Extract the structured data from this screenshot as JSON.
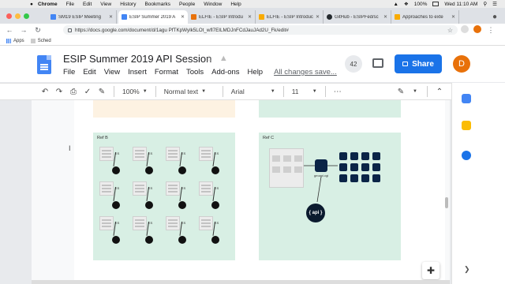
{
  "menubar": {
    "app": "Chrome",
    "items": [
      "File",
      "Edit",
      "View",
      "History",
      "Bookmarks",
      "People",
      "Window",
      "Help"
    ],
    "battery": "100%",
    "clock": "Wed 11:10 AM"
  },
  "tabs": [
    {
      "title": "SM19 ESIP Meeting",
      "color": "#4285f4"
    },
    {
      "title": "ESIP Summer 2019 A",
      "color": "#4285f4"
    },
    {
      "title": "ELFIE - ESIP Introdu",
      "color": "#e8710a"
    },
    {
      "title": "ELFIE - ESIP Introduc",
      "color": "#f9ab00"
    },
    {
      "title": "GitHub - ESIPFed/sc",
      "color": "#24292e"
    },
    {
      "title": "Approaches to exte",
      "color": "#f9ab00"
    }
  ],
  "address": {
    "url": "https://docs.google.com/document/d/1agu PfTKpWylk5LOt_wfl7EILMDJnFCdJauJAd2U_Fk/edit#"
  },
  "bookmarks": [
    {
      "label": "Apps"
    },
    {
      "label": "Sched"
    }
  ],
  "doc": {
    "title": "ESIP Summer 2019 API Session",
    "menus": [
      "File",
      "Edit",
      "View",
      "Insert",
      "Format",
      "Tools",
      "Add-ons",
      "Help"
    ],
    "saved_status": "All changes save...",
    "viewer_count": "42",
    "share_label": "Share",
    "avatar_letter": "D"
  },
  "toolbar": {
    "zoom": "100%",
    "style": "Normal text",
    "font": "Arial",
    "size": "11"
  },
  "content": {
    "panel_b_label": "Ref B",
    "panel_c_label": "Ref C",
    "api_label": "{ api }",
    "hub_label": "geoapi.cgi",
    "unit_tag": "ES"
  },
  "colors": {
    "accent": "#1a73e8",
    "panel_green": "#d8efe4",
    "panel_peach": "#fdf2e2"
  }
}
